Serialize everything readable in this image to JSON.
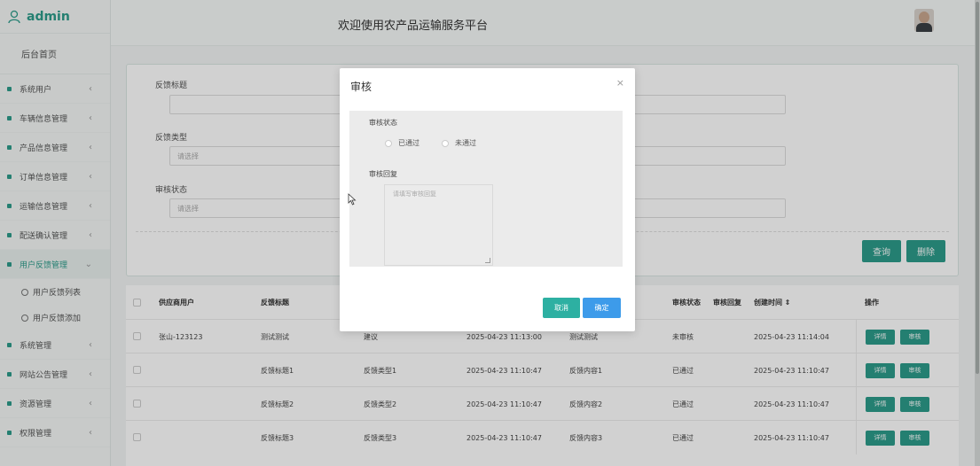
{
  "sidebar": {
    "brand": "admin",
    "home": "后台首页",
    "items": [
      {
        "label": "系统用户"
      },
      {
        "label": "车辆信息管理"
      },
      {
        "label": "产品信息管理"
      },
      {
        "label": "订单信息管理"
      },
      {
        "label": "运输信息管理"
      },
      {
        "label": "配送确认管理"
      },
      {
        "label": "用户反馈管理"
      },
      {
        "label": "系统管理"
      },
      {
        "label": "网站公告管理"
      },
      {
        "label": "资源管理"
      },
      {
        "label": "权限管理"
      }
    ],
    "subitems": [
      {
        "label": "用户反馈列表"
      },
      {
        "label": "用户反馈添加"
      }
    ]
  },
  "header": {
    "title": "欢迎使用农产品运输服务平台"
  },
  "filter": {
    "label1": "反馈标题",
    "label2": "反馈类型",
    "label3": "审核状态",
    "placeholder2": "请选择",
    "placeholder3": "请选择",
    "query": "查询",
    "delete": "删除"
  },
  "table": {
    "headers": {
      "supplier": "供应商用户",
      "title": "反馈标题",
      "status": "审核状态",
      "reply": "审核回复",
      "created": "创建时间 ⇕",
      "ops": "操作"
    },
    "rows": [
      {
        "supplier": "张山-123123",
        "title": "测试测试",
        "type": "建议",
        "time1": "2025-04-23 11:13:00",
        "content": "测试测试",
        "status": "未审核",
        "created": "2025-04-23 11:14:04"
      },
      {
        "supplier": "",
        "title": "反馈标题1",
        "type": "反馈类型1",
        "time1": "2025-04-23 11:10:47",
        "content": "反馈内容1",
        "status": "已通过",
        "created": "2025-04-23 11:10:47"
      },
      {
        "supplier": "",
        "title": "反馈标题2",
        "type": "反馈类型2",
        "time1": "2025-04-23 11:10:47",
        "content": "反馈内容2",
        "status": "已通过",
        "created": "2025-04-23 11:10:47"
      },
      {
        "supplier": "",
        "title": "反馈标题3",
        "type": "反馈类型3",
        "time1": "2025-04-23 11:10:47",
        "content": "反馈内容3",
        "status": "已通过",
        "created": "2025-04-23 11:10:47"
      }
    ],
    "detail": "详情",
    "audit": "审核"
  },
  "modal": {
    "title": "审核",
    "close": "×",
    "status_label": "审核状态",
    "option_pass": "已通过",
    "option_fail": "未通过",
    "reply_label": "审核回复",
    "reply_placeholder": "请填写审核回复",
    "cancel": "取消",
    "confirm": "确定"
  },
  "colors": {
    "accent": "#2d9c8a",
    "confirm": "#3d9bea"
  }
}
